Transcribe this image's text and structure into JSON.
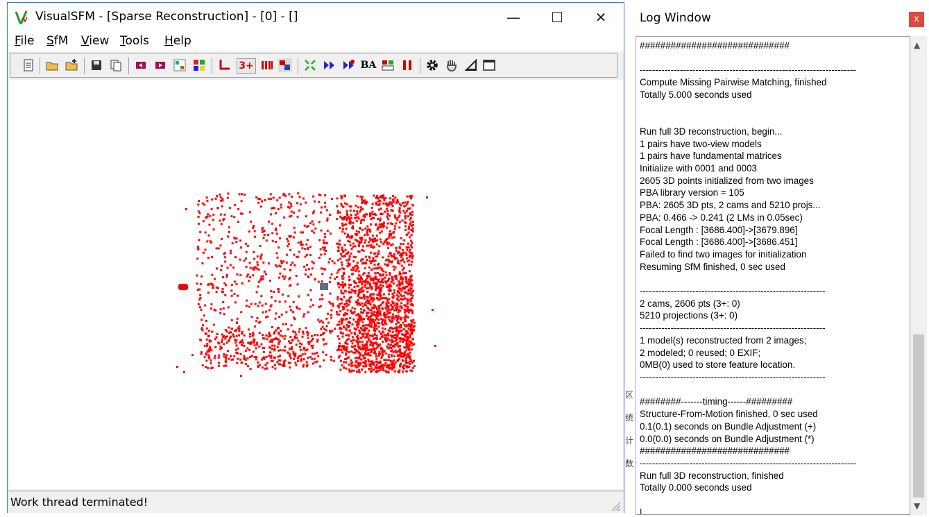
{
  "main_window": {
    "title": "VisualSFM - [Sparse Reconstruction] - [0] - []",
    "buttons": {
      "minimize": "—",
      "maximize": "☐",
      "close": "✕"
    },
    "menu": [
      "File",
      "SfM",
      "View",
      "Tools",
      "Help"
    ],
    "menu_access_keys": [
      "F",
      "S",
      "V",
      "T",
      "H"
    ],
    "toolbar": {
      "text_buttons": {
        "threeplus": "3+",
        "ba": "BA"
      },
      "icons": [
        "log-icon",
        "open-multi-icon",
        "add-images-icon",
        "save-icon",
        "copy-icon",
        "prev-icon",
        "next-icon",
        "pair-list-icon",
        "grid-icon",
        "axis-icon",
        "threeplus-icon",
        "match-icon",
        "camera-icon",
        "fullscreen-icon",
        "forward-icon",
        "compute-icon",
        "ba-icon",
        "compare-icon",
        "pause-icon",
        "gear-icon",
        "hand-icon",
        "ruler-icon",
        "window-icon"
      ]
    },
    "status": "Work thread terminated!",
    "colors": {
      "points": "#ff0000",
      "camera": "#5a6f8a",
      "accent": "#2b7fd6"
    }
  },
  "vertical_strip": [
    "区",
    "统",
    "计",
    "数"
  ],
  "log_window": {
    "title": "Log Window",
    "close_label": "x",
    "lines": [
      "#############################",
      "",
      "----------------------------------------------------------------------",
      "Compute Missing Pairwise Matching, finished",
      "Totally 5.000 seconds used",
      "",
      "",
      "Run full 3D reconstruction, begin...",
      "1 pairs have two-view models",
      "1 pairs have fundamental matrices",
      "Initialize with 0001 and 0003",
      "2605 3D points initialized from two images",
      "PBA library version = 105",
      "PBA: 2605 3D pts, 2 cams and 5210 projs...",
      "PBA: 0.466 -> 0.241 (2 LMs in 0.05sec)",
      "Focal Length : [3686.400]->[3679.896]",
      "Focal Length : [3686.400]->[3686.451]",
      "Failed to find two images for initialization",
      "Resuming SfM finished, 0 sec used",
      "",
      "------------------------------------------------------------",
      "2 cams, 2606 pts (3+: 0)",
      "5210 projections (3+: 0)",
      "------------------------------------------------------------",
      "1 model(s) reconstructed from 2 images;",
      "2 modeled; 0 reused; 0 EXIF;",
      "0MB(0) used to store feature location.",
      "------------------------------------------------------------",
      "",
      "########-------timing------#########",
      "Structure-From-Motion finished, 0 sec used",
      "0.1(0.1) seconds on Bundle Adjustment (+)",
      "0.0(0.0) seconds on Bundle Adjustment (*)",
      "#############################",
      "----------------------------------------------------------------------",
      "Run full 3D reconstruction, finished",
      "Totally 0.000 seconds used",
      "",
      "|"
    ]
  }
}
